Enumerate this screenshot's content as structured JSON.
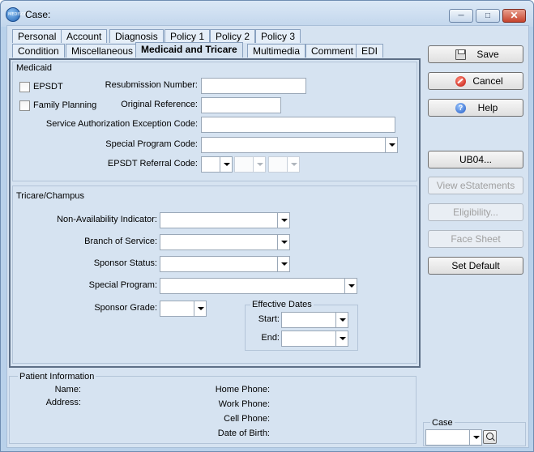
{
  "window": {
    "title": "Case:",
    "icon": "app-globe-icon",
    "icon_text": "MEDISOFT"
  },
  "tabs": {
    "row1": [
      "Personal",
      "Account",
      "Diagnosis",
      "Policy 1",
      "Policy 2",
      "Policy 3"
    ],
    "row2": [
      "Condition",
      "Miscellaneous",
      "Medicaid and Tricare",
      "Multimedia",
      "Comment",
      "EDI"
    ],
    "active": "Medicaid and Tricare"
  },
  "medicaid": {
    "title": "Medicaid",
    "epsdt": "EPSDT",
    "family_planning": "Family Planning",
    "resubmission_number": "Resubmission Number:",
    "original_reference": "Original Reference:",
    "service_authorization": "Service Authorization Exception Code:",
    "special_program_code": "Special Program Code:",
    "epsdt_referral_code": "EPSDT Referral Code:"
  },
  "tricare": {
    "title": "Tricare/Champus",
    "non_availability": "Non-Availability Indicator:",
    "branch_of_service": "Branch of Service:",
    "sponsor_status": "Sponsor Status:",
    "special_program": "Special Program:",
    "sponsor_grade": "Sponsor Grade:",
    "effective_dates": "Effective Dates",
    "start": "Start:",
    "end": "End:"
  },
  "patient_info": {
    "title": "Patient Information",
    "name": "Name:",
    "address": "Address:",
    "home_phone": "Home Phone:",
    "work_phone": "Work Phone:",
    "cell_phone": "Cell Phone:",
    "date_of_birth": "Date of Birth:"
  },
  "buttons": {
    "save": "Save",
    "cancel": "Cancel",
    "help": "Help",
    "ub04": "UB04...",
    "view_estatements": "View eStatements",
    "eligibility": "Eligibility...",
    "face_sheet": "Face Sheet",
    "set_default": "Set Default"
  },
  "case_box": {
    "label": "Case"
  }
}
